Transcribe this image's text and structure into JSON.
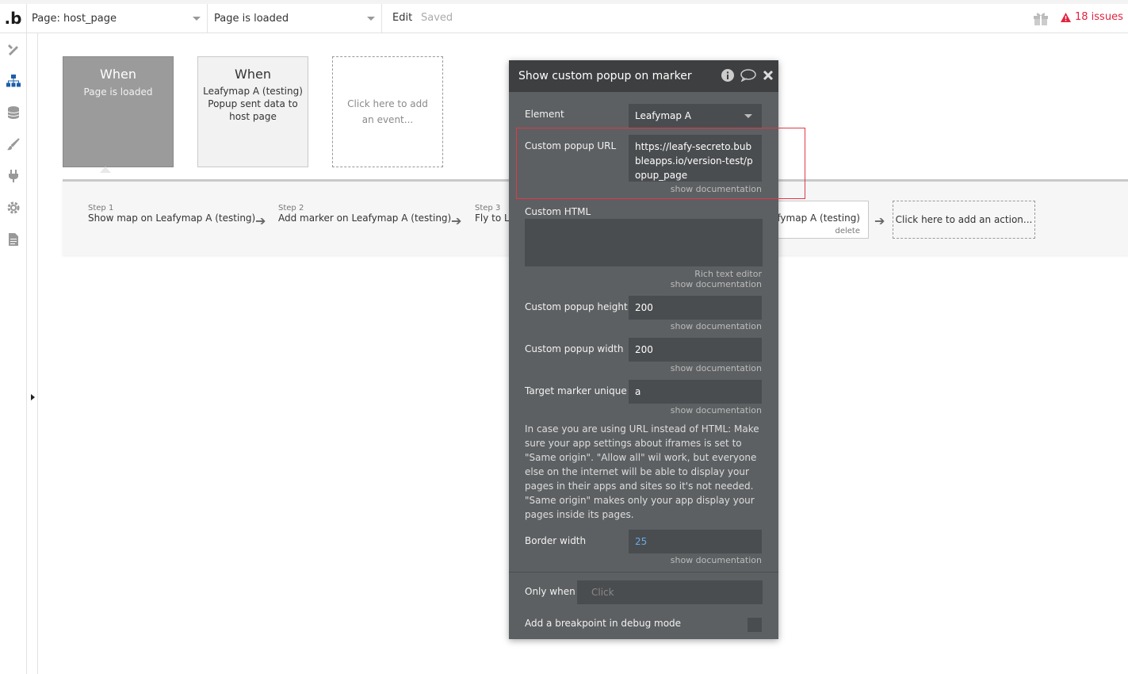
{
  "topbar": {
    "logo": ".b",
    "page_selector": "Page: host_page",
    "event_selector": "Page is loaded",
    "edit_label": "Edit",
    "saved_label": "Saved",
    "issues_label": "18 issues",
    "issues_color": "#e2243f"
  },
  "sidebar": {
    "icons": [
      "design-icon",
      "workflow-icon",
      "data-icon",
      "styles-icon",
      "plugins-icon",
      "settings-icon",
      "logs-icon"
    ],
    "active_color": "#1d5fa8"
  },
  "events": [
    {
      "title": "When",
      "subtitle": "Page is loaded",
      "selected": true
    },
    {
      "title": "When",
      "subtitle": "Leafymap A (testing) Popup sent data to host page",
      "selected": false
    },
    {
      "title": "",
      "subtitle": "Click here to add an event...",
      "selected": false
    }
  ],
  "steps": [
    {
      "num": "Step 1",
      "label": "Show map on Leafymap A (testing)"
    },
    {
      "num": "Step 2",
      "label": "Add marker on Leafymap A (testing)"
    },
    {
      "num": "Step 3",
      "label": "Fly to Le"
    },
    {
      "num": "",
      "label": "eafymap A (testing)",
      "delete": "delete"
    }
  ],
  "add_action": "Click here to add an action...",
  "panel": {
    "title": "Show custom popup on marker",
    "element_label": "Element",
    "element_value": "Leafymap A",
    "popup_url_label": "Custom popup URL",
    "popup_url_value": "https://leafy-secreto.bubbleapps.io/version-test/popup_page",
    "show_doc": "show documentation",
    "custom_html_label": "Custom HTML",
    "rich_text": "Rich text editor",
    "height_label": "Custom popup height",
    "height_value": "200",
    "width_label": "Custom popup width",
    "width_value": "200",
    "target_label": "Target marker unique",
    "target_value": "a",
    "note": "In case you are using URL instead of HTML: Make sure your app settings about iframes is set to \"Same origin\". \"Allow all\" wil work, but everyone else on the internet will be able to display your pages in their apps and sites so it's not needed. \"Same origin\" makes only your app display your pages inside its pages.",
    "border_label": "Border width",
    "border_value": "25",
    "border_value_color": "#6aa9e8",
    "only_when_label": "Only when",
    "only_when_placeholder": "Click",
    "breakpoint_label": "Add a breakpoint in debug mode"
  }
}
